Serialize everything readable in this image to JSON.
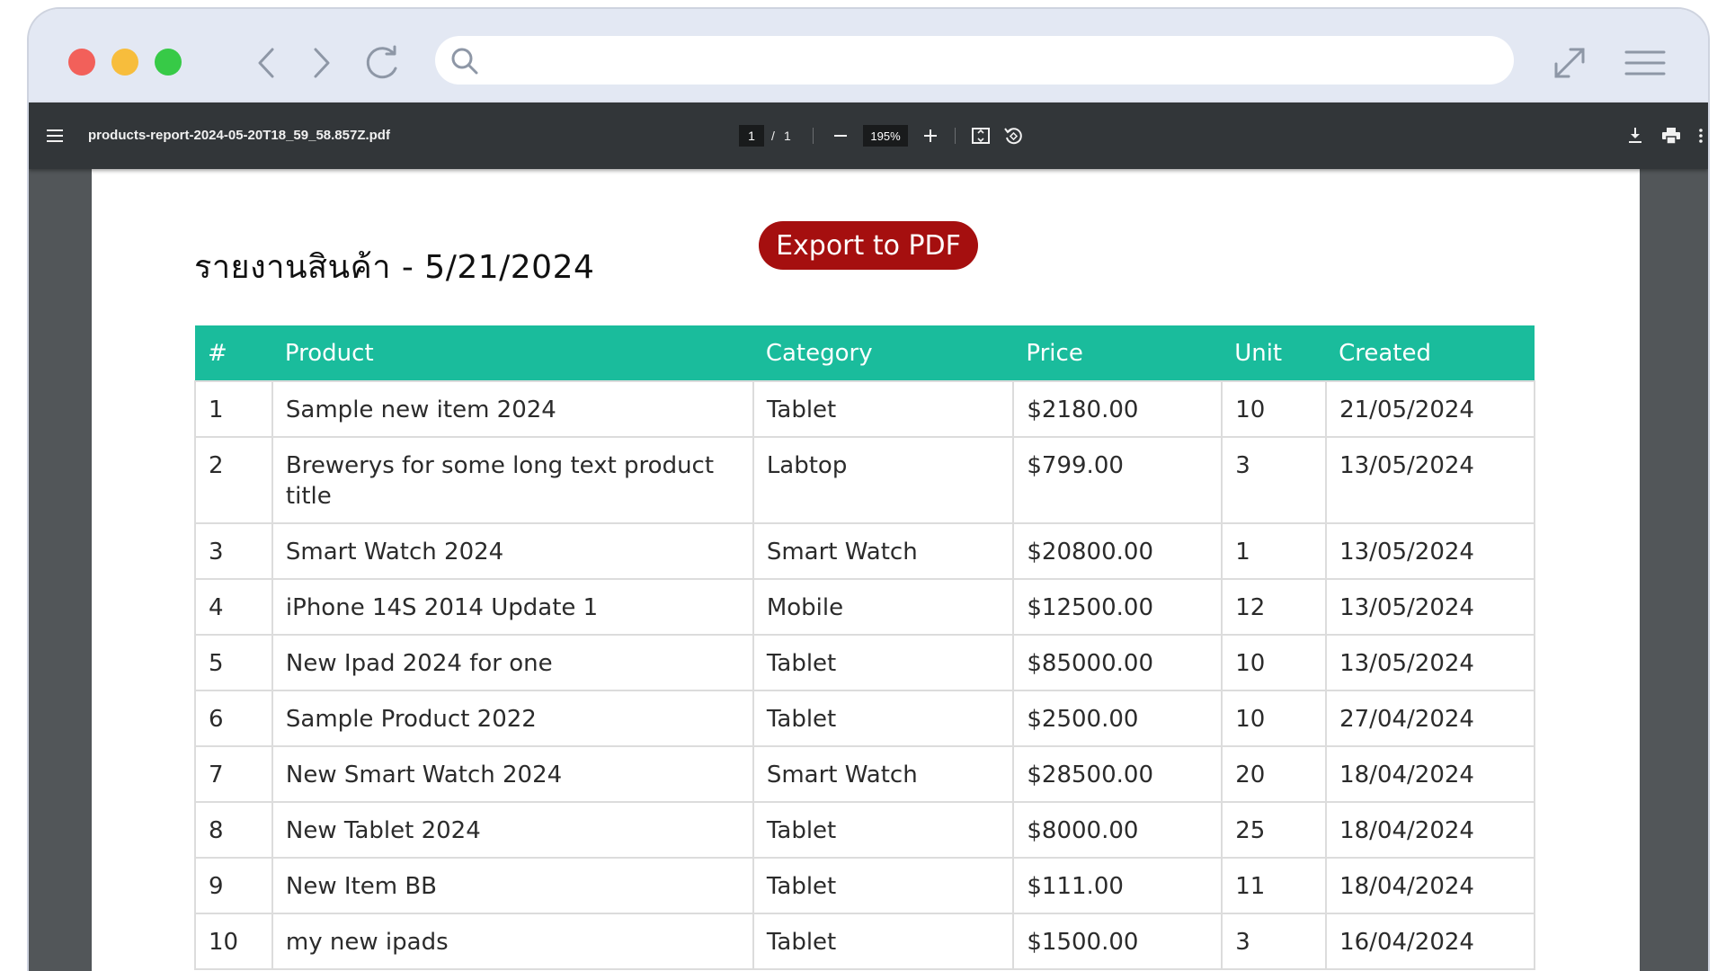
{
  "browser": {
    "address_value": "",
    "icons": {
      "back": "chevron-left-icon",
      "forward": "chevron-right-icon",
      "reload": "reload-icon",
      "search": "search-icon",
      "expand": "expand-icon",
      "menu": "hamburger-menu-icon"
    }
  },
  "viewer": {
    "file_name": "products-report-2024-05-20T18_59_58.857Z.pdf",
    "page_current": "1",
    "page_separator": "/",
    "page_total": "1",
    "zoom": "195%"
  },
  "report": {
    "title": "รายงานสินค้า - 5/21/2024",
    "export_label": "Export to PDF",
    "accent_color": "#1abc9c",
    "export_color": "#a50f0f",
    "columns": [
      "#",
      "Product",
      "Category",
      "Price",
      "Unit",
      "Created"
    ],
    "rows": [
      [
        "1",
        "Sample new item 2024",
        "Tablet",
        "$2180.00",
        "10",
        "21/05/2024"
      ],
      [
        "2",
        "Brewerys for some long text product title",
        "Labtop",
        "$799.00",
        "3",
        "13/05/2024"
      ],
      [
        "3",
        "Smart Watch 2024",
        "Smart Watch",
        "$20800.00",
        "1",
        "13/05/2024"
      ],
      [
        "4",
        "iPhone 14S 2014 Update 1",
        "Mobile",
        "$12500.00",
        "12",
        "13/05/2024"
      ],
      [
        "5",
        "New Ipad 2024 for one",
        "Tablet",
        "$85000.00",
        "10",
        "13/05/2024"
      ],
      [
        "6",
        "Sample Product 2022",
        "Tablet",
        "$2500.00",
        "10",
        "27/04/2024"
      ],
      [
        "7",
        "New Smart Watch 2024",
        "Smart Watch",
        "$28500.00",
        "20",
        "18/04/2024"
      ],
      [
        "8",
        "New Tablet 2024",
        "Tablet",
        "$8000.00",
        "25",
        "18/04/2024"
      ],
      [
        "9",
        "New Item BB",
        "Tablet",
        "$111.00",
        "11",
        "18/04/2024"
      ],
      [
        "10",
        "my new ipads",
        "Tablet",
        "$1500.00",
        "3",
        "16/04/2024"
      ]
    ]
  }
}
